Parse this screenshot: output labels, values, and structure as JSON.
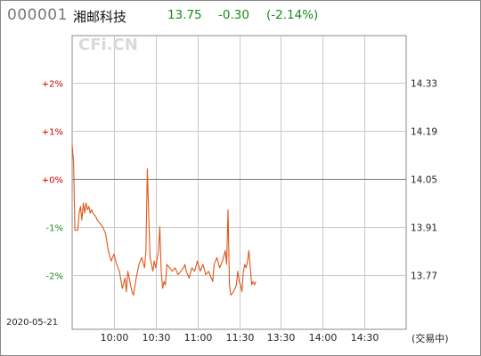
{
  "header": {
    "code": "000001",
    "name": "湘邮科技",
    "price": "13.75",
    "change": "-0.30",
    "change_pct": "(-2.14%)"
  },
  "watermark": "CFi.CN",
  "date": "2020-05-21",
  "status": "(交易中)",
  "colors": {
    "up": "#cc0000",
    "flat": "#cc0000",
    "down": "#1a8a1a",
    "line": "#e0561c",
    "grid": "#c8c8c8",
    "zero_line": "#777777"
  },
  "chart_data": {
    "type": "line",
    "prev_close": 14.05,
    "left_ticks": [
      {
        "label": "+2%",
        "value": 2,
        "color": "up"
      },
      {
        "label": "+1%",
        "value": 1,
        "color": "up"
      },
      {
        "label": "+0%",
        "value": 0,
        "color": "flat"
      },
      {
        "label": "-1%",
        "value": -1,
        "color": "down"
      },
      {
        "label": "-2%",
        "value": -2,
        "color": "down"
      }
    ],
    "right_ticks": [
      "14.33",
      "14.19",
      "14.05",
      "13.91",
      "13.77"
    ],
    "x_ticks": [
      "10:00",
      "10:30",
      "11:00",
      "11:30",
      "13:30",
      "14:00",
      "14:30"
    ],
    "price_range": [
      13.61,
      14.47
    ],
    "session_minutes": 240,
    "x": [
      0,
      1,
      2,
      3,
      4,
      5,
      6,
      7,
      8,
      9,
      10,
      11,
      12,
      13,
      14,
      15,
      17,
      18,
      20,
      22,
      24,
      26,
      28,
      30,
      32,
      34,
      36,
      38,
      39,
      40,
      42,
      43,
      44,
      46,
      48,
      50,
      52,
      53,
      54,
      55,
      56,
      57,
      58,
      59,
      60,
      62,
      63,
      64,
      65,
      66,
      67,
      68,
      70,
      72,
      74,
      76,
      78,
      80,
      81,
      82,
      84,
      86,
      88,
      90,
      92,
      94,
      96,
      98,
      100,
      101,
      102,
      104,
      106,
      108,
      110,
      111,
      112,
      113,
      114,
      116,
      118,
      119,
      120,
      121,
      122,
      123,
      124,
      125,
      126,
      127,
      128,
      129,
      130,
      131,
      132
    ],
    "y": [
      14.15,
      14.1,
      13.9,
      13.9,
      13.9,
      13.95,
      13.97,
      13.93,
      13.98,
      13.95,
      13.98,
      13.96,
      13.97,
      13.95,
      13.96,
      13.95,
      13.94,
      13.93,
      13.92,
      13.91,
      13.89,
      13.84,
      13.81,
      13.83,
      13.8,
      13.78,
      13.73,
      13.76,
      13.72,
      13.78,
      13.74,
      13.72,
      13.71,
      13.76,
      13.8,
      13.82,
      13.79,
      13.84,
      14.08,
      13.95,
      13.82,
      13.8,
      13.78,
      13.81,
      13.79,
      13.84,
      13.91,
      13.78,
      13.73,
      13.75,
      13.74,
      13.8,
      13.79,
      13.78,
      13.79,
      13.77,
      13.78,
      13.79,
      13.8,
      13.78,
      13.76,
      13.79,
      13.78,
      13.81,
      13.78,
      13.8,
      13.77,
      13.78,
      13.76,
      13.75,
      13.8,
      13.82,
      13.79,
      13.81,
      13.84,
      13.8,
      13.96,
      13.74,
      13.71,
      13.72,
      13.74,
      13.78,
      13.75,
      13.74,
      13.72,
      13.78,
      13.8,
      13.79,
      13.81,
      13.84,
      13.79,
      13.74,
      13.75,
      13.74,
      13.75
    ]
  }
}
